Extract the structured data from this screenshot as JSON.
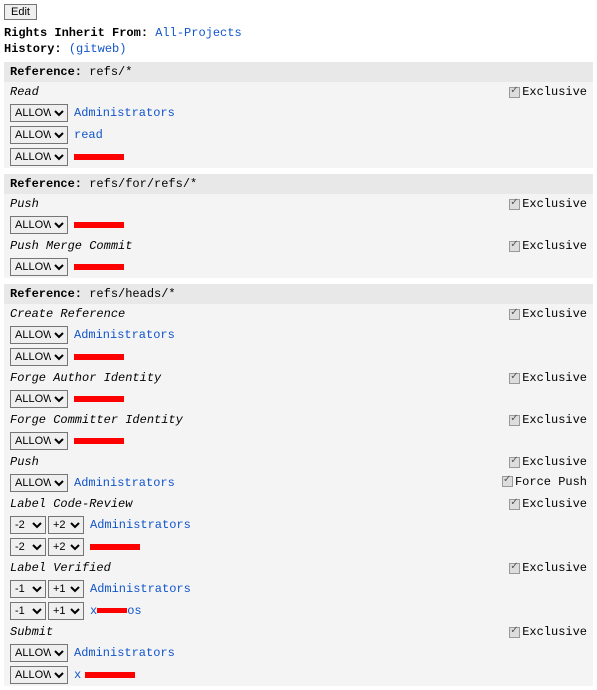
{
  "edit_label": "Edit",
  "rights_inherit_label": "Rights Inherit From",
  "rights_inherit_link": "All-Projects",
  "history_label": "History",
  "history_link": "(gitweb)",
  "reference_label": "Reference",
  "exclusive_label": "Exclusive",
  "force_push_label": "Force Push",
  "allow_option": "ALLOW",
  "vote_neg2": "-2",
  "vote_pos2": "+2",
  "vote_neg1": "-1",
  "vote_pos1": "+1",
  "sections": [
    {
      "ref": "refs/*",
      "perms": [
        {
          "title": "Read",
          "exclusive": true,
          "rows": [
            {
              "type": "allow",
              "group": "Administrators"
            },
            {
              "type": "allow",
              "group": "read"
            },
            {
              "type": "allow",
              "redacted": true,
              "strike": true
            }
          ]
        }
      ]
    },
    {
      "ref": "refs/for/refs/*",
      "perms": [
        {
          "title": "Push",
          "exclusive": true,
          "rows": [
            {
              "type": "allow",
              "redacted": true
            }
          ]
        },
        {
          "title": "Push Merge Commit",
          "exclusive": true,
          "rows": [
            {
              "type": "allow",
              "redacted": true
            }
          ]
        }
      ]
    },
    {
      "ref": "refs/heads/*",
      "perms": [
        {
          "title": "Create Reference",
          "exclusive": true,
          "rows": [
            {
              "type": "allow",
              "group": "Administrators"
            },
            {
              "type": "allow",
              "redacted": true,
              "strike": true
            }
          ]
        },
        {
          "title": "Forge Author Identity",
          "exclusive": true,
          "rows": [
            {
              "type": "allow",
              "redacted": true
            }
          ]
        },
        {
          "title": "Forge Committer Identity",
          "exclusive": true,
          "rows": [
            {
              "type": "allow",
              "redacted": true
            }
          ]
        },
        {
          "title": "Push",
          "exclusive": true,
          "force_push": true,
          "rows": [
            {
              "type": "allow",
              "group": "Administrators"
            }
          ]
        },
        {
          "title": "Label Code-Review",
          "exclusive": true,
          "rows": [
            {
              "type": "vote",
              "min": "-2",
              "max": "+2",
              "group": "Administrators"
            },
            {
              "type": "vote",
              "min": "-2",
              "max": "+2",
              "redacted": true
            }
          ]
        },
        {
          "title": "Label Verified",
          "exclusive": true,
          "rows": [
            {
              "type": "vote",
              "min": "-1",
              "max": "+1",
              "group": "Administrators"
            },
            {
              "type": "vote",
              "min": "-1",
              "max": "+1",
              "mixed": "x",
              "mixedTail": "os"
            }
          ]
        },
        {
          "title": "Submit",
          "exclusive": true,
          "rows": [
            {
              "type": "allow",
              "group": "Administrators"
            },
            {
              "type": "allow",
              "redacted": true,
              "prefix": "x"
            }
          ]
        }
      ]
    }
  ]
}
